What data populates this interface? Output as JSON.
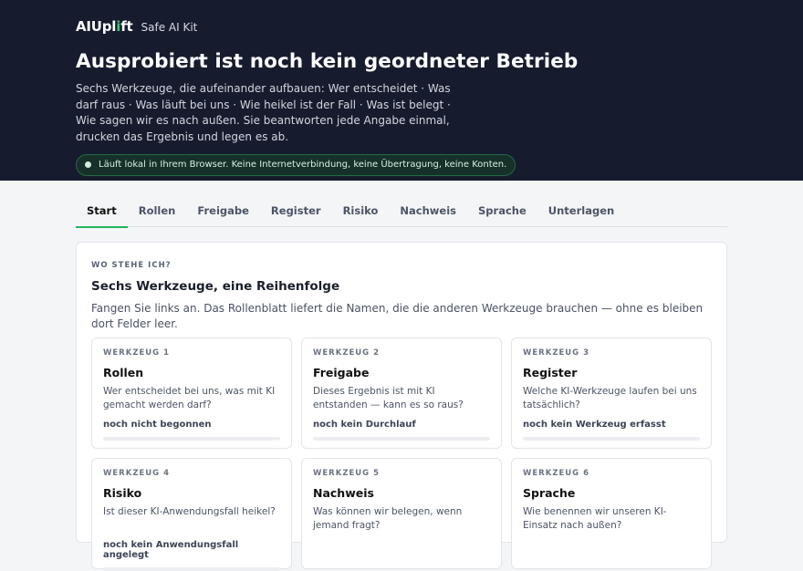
{
  "brand": {
    "logo_prefix": "AIUpl",
    "logo_accent": "i",
    "logo_suffix": "ft",
    "subtitle": "Safe AI Kit"
  },
  "hero": {
    "title": "Ausprobiert ist noch kein geordneter Betrieb",
    "description": "Sechs Werkzeuge, die aufeinander aufbauen: Wer entscheidet · Was darf raus · Was läuft bei uns · Wie heikel ist der Fall · Was ist belegt · Wie sagen wir es nach außen. Sie beantworten jede Angabe einmal, drucken das Ergebnis und legen es ab.",
    "badge": "Läuft lokal in Ihrem Browser. Keine Internetverbindung, keine Übertragung, keine Konten."
  },
  "tabs": [
    "Start",
    "Rollen",
    "Freigabe",
    "Register",
    "Risiko",
    "Nachweis",
    "Sprache",
    "Unterlagen"
  ],
  "active_tab": "Start",
  "panel": {
    "eyebrow": "WO STEHE ICH?",
    "title": "Sechs Werkzeuge, eine Reihenfolge",
    "description": "Fangen Sie links an. Das Rollenblatt liefert die Namen, die die anderen Werkzeuge brauchen — ohne es bleiben dort Felder leer."
  },
  "cards": [
    {
      "kicker": "WERKZEUG 1",
      "title": "Rollen",
      "question": "Wer entscheidet bei uns, was mit KI gemacht werden darf?",
      "status": "noch nicht begonnen",
      "progress": 0
    },
    {
      "kicker": "WERKZEUG 2",
      "title": "Freigabe",
      "question": "Dieses Ergebnis ist mit KI entstanden — kann es so raus?",
      "status": "noch kein Durchlauf",
      "progress": 0
    },
    {
      "kicker": "WERKZEUG 3",
      "title": "Register",
      "question": "Welche KI-Werkzeuge laufen bei uns tatsächlich?",
      "status": "noch kein Werkzeug erfasst",
      "progress": 0
    },
    {
      "kicker": "WERKZEUG 4",
      "title": "Risiko",
      "question": "Ist dieser KI-Anwendungsfall heikel?",
      "status": "noch kein Anwendungsfall angelegt",
      "progress": 0
    },
    {
      "kicker": "WERKZEUG 5",
      "title": "Nachweis",
      "question": "Was können wir belegen, wenn jemand fragt?",
      "status": "",
      "progress": 0
    },
    {
      "kicker": "WERKZEUG 6",
      "title": "Sprache",
      "question": "Wie benennen wir unseren KI-Einsatz nach außen?",
      "status": "",
      "progress": 0
    }
  ],
  "colors": {
    "hero_bg": "#161b2e",
    "accent": "#22b35e",
    "page_bg": "#f4f5f7"
  }
}
